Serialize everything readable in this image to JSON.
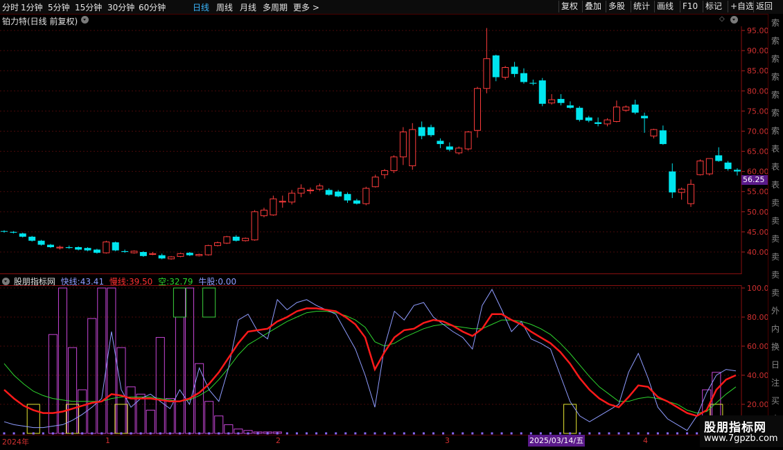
{
  "toolbar": {
    "periods": [
      "分时",
      "1分钟",
      "5分钟",
      "15分钟",
      "30分钟",
      "60分钟",
      "日线",
      "周线",
      "月线",
      "多周期",
      "更多 >"
    ],
    "active_period": "日线",
    "right_buttons": [
      "复权",
      "叠加",
      "多股",
      "统计",
      "画线",
      "F10",
      "标记",
      "+自选",
      "返回"
    ]
  },
  "title": "铂力特(日线 前复权)",
  "price_axis": [
    "95.00",
    "90.00",
    "85.00",
    "80.00",
    "75.00",
    "70.00",
    "65.00",
    "60.00",
    "55.00",
    "50.00",
    "45.00",
    "40.00"
  ],
  "last_price": "56.25",
  "indicator": {
    "name": "股朋指标网",
    "fast_label": "快线:",
    "fast_value": "43.41",
    "slow_label": "慢线:",
    "slow_value": "39.50",
    "empty_label": "空:",
    "empty_value": "32.79",
    "bull_label": "牛股:",
    "bull_value": "0.00",
    "axis": [
      "100.0",
      "80.00",
      "60.00",
      "40.00",
      "20.00"
    ],
    "colors": {
      "fast": "#8f9cff",
      "slow": "#ff1a1a",
      "empty": "#2ed62e",
      "bars": "#c846d8",
      "boxes_up": "#e6e632",
      "boxes_down": "#3cd23c"
    }
  },
  "date_axis": [
    "2024年",
    "1",
    "2",
    "3",
    "4"
  ],
  "crosshair_date": "2025/03/14/五",
  "right_strip_chars": [
    "索",
    "索",
    "索",
    "索",
    "索",
    "索",
    "索",
    "表",
    "表",
    "表",
    "卖",
    "卖",
    "卖",
    "卖",
    "卖",
    "卖",
    "外",
    "内",
    "换",
    "日",
    "注",
    "买",
    "卖"
  ],
  "watermark": {
    "line1": "股朋指标网",
    "line2": "www.7gpzb.com"
  },
  "chart_data": [
    {
      "type": "candlestick",
      "title": "铂力特(日线 前复权)",
      "ylim": [
        35,
        97
      ],
      "up_color": "#ff3c3c",
      "down_color": "#00e5ee",
      "candles": [
        [
          45.2,
          45.4,
          44.8,
          45.1
        ],
        [
          45.0,
          45.2,
          44.6,
          44.8
        ],
        [
          44.6,
          44.8,
          43.6,
          43.8
        ],
        [
          43.8,
          44.0,
          42.6,
          42.8
        ],
        [
          42.8,
          43.0,
          41.6,
          41.8
        ],
        [
          41.8,
          42.0,
          41.0,
          41.2
        ],
        [
          41.0,
          41.6,
          40.6,
          41.2
        ],
        [
          41.2,
          41.6,
          40.8,
          41.0
        ],
        [
          41.2,
          41.4,
          40.4,
          40.6
        ],
        [
          41.0,
          41.2,
          40.2,
          40.4
        ],
        [
          40.6,
          40.8,
          39.6,
          39.8
        ],
        [
          39.8,
          42.8,
          39.6,
          42.5
        ],
        [
          42.4,
          42.6,
          40.2,
          40.4
        ],
        [
          40.2,
          40.6,
          39.8,
          40.0
        ],
        [
          39.8,
          40.4,
          39.6,
          40.2
        ],
        [
          40.0,
          40.2,
          38.8,
          39.0
        ],
        [
          39.4,
          40.0,
          39.2,
          39.6
        ],
        [
          39.2,
          39.6,
          38.2,
          38.4
        ],
        [
          38.3,
          39.0,
          38.1,
          38.8
        ],
        [
          38.9,
          39.8,
          38.7,
          39.6
        ],
        [
          39.8,
          40.0,
          39.0,
          39.2
        ],
        [
          39.1,
          39.6,
          38.9,
          39.4
        ],
        [
          39.3,
          41.8,
          39.1,
          41.6
        ],
        [
          41.6,
          42.6,
          41.4,
          42.3
        ],
        [
          42.2,
          44.0,
          42.0,
          43.8
        ],
        [
          43.8,
          44.2,
          42.6,
          42.8
        ],
        [
          42.8,
          43.6,
          42.6,
          43.4
        ],
        [
          43.0,
          50.4,
          42.8,
          50.0
        ],
        [
          49.0,
          51.0,
          48.6,
          50.4
        ],
        [
          49.2,
          54.0,
          49.0,
          53.2
        ],
        [
          52.4,
          54.0,
          51.0,
          52.6
        ],
        [
          52.4,
          55.4,
          51.8,
          54.6
        ],
        [
          54.6,
          56.8,
          53.6,
          55.8
        ],
        [
          55.2,
          56.0,
          54.4,
          55.4
        ],
        [
          55.6,
          57.0,
          55.2,
          56.4
        ],
        [
          55.4,
          55.8,
          54.0,
          54.2
        ],
        [
          55.0,
          55.4,
          53.6,
          53.8
        ],
        [
          54.4,
          54.8,
          52.2,
          52.8
        ],
        [
          52.8,
          53.2,
          51.8,
          52.0
        ],
        [
          52.0,
          56.2,
          51.6,
          55.8
        ],
        [
          56.2,
          59.2,
          56.0,
          58.6
        ],
        [
          59.2,
          60.6,
          58.2,
          60.2
        ],
        [
          60.2,
          64.0,
          59.6,
          63.6
        ],
        [
          63.6,
          71.0,
          61.6,
          69.8
        ],
        [
          61.4,
          72.0,
          60.4,
          70.4
        ],
        [
          71.0,
          72.4,
          68.0,
          68.8
        ],
        [
          71.0,
          71.6,
          68.6,
          69.0
        ],
        [
          67.6,
          68.2,
          65.8,
          66.8
        ],
        [
          66.2,
          67.2,
          65.0,
          65.4
        ],
        [
          64.6,
          66.2,
          64.2,
          65.8
        ],
        [
          65.6,
          70.0,
          65.2,
          69.8
        ],
        [
          70.2,
          81.0,
          68.4,
          80.6
        ],
        [
          80.6,
          95.6,
          79.4,
          88.0
        ],
        [
          88.8,
          89.0,
          82.4,
          83.4
        ],
        [
          83.4,
          86.2,
          82.8,
          85.8
        ],
        [
          86.0,
          87.2,
          83.4,
          84.2
        ],
        [
          84.4,
          85.6,
          81.8,
          82.2
        ],
        [
          82.0,
          82.8,
          81.4,
          81.8
        ],
        [
          82.6,
          83.2,
          76.2,
          76.8
        ],
        [
          77.0,
          79.2,
          76.6,
          77.8
        ],
        [
          78.0,
          79.2,
          76.4,
          77.0
        ],
        [
          76.4,
          77.4,
          75.6,
          75.8
        ],
        [
          75.8,
          76.2,
          72.4,
          72.8
        ],
        [
          73.4,
          73.8,
          72.2,
          72.6
        ],
        [
          72.2,
          73.4,
          71.2,
          71.8
        ],
        [
          71.8,
          73.2,
          71.2,
          72.8
        ],
        [
          72.4,
          77.6,
          72.2,
          76.0
        ],
        [
          75.2,
          76.4,
          74.8,
          76.0
        ],
        [
          76.6,
          77.8,
          74.2,
          74.6
        ],
        [
          73.8,
          74.6,
          69.6,
          73.2
        ],
        [
          68.8,
          70.6,
          68.2,
          70.4
        ],
        [
          70.2,
          71.4,
          66.6,
          66.8
        ],
        [
          60.0,
          62.0,
          53.4,
          54.8
        ],
        [
          54.8,
          56.0,
          53.0,
          55.6
        ],
        [
          52.0,
          58.0,
          51.2,
          56.8
        ],
        [
          59.2,
          63.0,
          59.0,
          62.6
        ],
        [
          59.4,
          63.2,
          59.0,
          63.2
        ],
        [
          64.0,
          66.0,
          62.4,
          62.6
        ],
        [
          62.2,
          62.6,
          60.2,
          60.6
        ],
        [
          60.4,
          60.8,
          59.0,
          60.0
        ]
      ]
    },
    {
      "type": "line",
      "title": "股朋指标网",
      "ylim": [
        0,
        110
      ],
      "series": [
        {
          "name": "快线",
          "values": [
            8,
            6,
            5,
            4,
            4,
            5,
            6,
            9,
            13,
            18,
            24,
            70,
            30,
            18,
            24,
            27,
            22,
            17,
            30,
            20,
            45,
            30,
            22,
            45,
            78,
            82,
            70,
            65,
            92,
            85,
            90,
            92,
            88,
            85,
            82,
            70,
            58,
            40,
            18,
            60,
            84,
            78,
            88,
            90,
            80,
            75,
            70,
            66,
            58,
            88,
            99,
            85,
            70,
            77,
            65,
            62,
            58,
            40,
            22,
            12,
            8,
            12,
            16,
            20,
            42,
            55,
            38,
            18,
            10,
            6,
            2,
            12,
            28,
            40,
            44,
            43
          ]
        },
        {
          "name": "慢线",
          "values": [
            30,
            24,
            19,
            16,
            14,
            14,
            15,
            17,
            19,
            21,
            22,
            27,
            26,
            24,
            24,
            24,
            23,
            22,
            22,
            24,
            28,
            34,
            42,
            52,
            62,
            70,
            71,
            72,
            77,
            80,
            84,
            86,
            86,
            85,
            84,
            80,
            75,
            66,
            44,
            56,
            66,
            71,
            72,
            76,
            78,
            77,
            74,
            70,
            67,
            72,
            82,
            82,
            78,
            75,
            70,
            66,
            62,
            56,
            48,
            38,
            30,
            24,
            20,
            18,
            25,
            33,
            32,
            25,
            22,
            18,
            14,
            12,
            16,
            30,
            37,
            40
          ]
        },
        {
          "name": "空",
          "values": [
            48,
            40,
            34,
            29,
            26,
            24,
            23,
            22,
            22,
            22,
            22,
            24,
            25,
            25,
            25,
            25,
            24,
            23,
            22,
            23,
            26,
            30,
            37,
            45,
            54,
            61,
            65,
            69,
            73,
            77,
            80,
            83,
            84,
            84,
            83,
            81,
            78,
            73,
            63,
            60,
            62,
            66,
            69,
            72,
            74,
            75,
            74,
            73,
            72,
            72,
            75,
            78,
            78,
            77,
            75,
            72,
            68,
            62,
            55,
            47,
            39,
            32,
            27,
            22,
            22,
            24,
            25,
            24,
            22,
            20,
            16,
            14,
            15,
            21,
            27,
            32
          ]
        },
        {
          "name": "牛股",
          "values": [
            0,
            0,
            0,
            0,
            0,
            0,
            0,
            0,
            0,
            0,
            0,
            0,
            0,
            0,
            0,
            0,
            0,
            0,
            0,
            0,
            0,
            0,
            0,
            0,
            0,
            0,
            0,
            0,
            0,
            0,
            0,
            0,
            0,
            0,
            0,
            0,
            0,
            0,
            0,
            0,
            0,
            0,
            0,
            0,
            0,
            0,
            0,
            0,
            0,
            0,
            0,
            0,
            0,
            0,
            0,
            0,
            0,
            0,
            0,
            0,
            0,
            0,
            0,
            0,
            0,
            0,
            0,
            0,
            0,
            0,
            0,
            0,
            0,
            0,
            0,
            0
          ]
        }
      ],
      "histogram": [
        0,
        0,
        0,
        0,
        0,
        68,
        100,
        59,
        30,
        79,
        100,
        100,
        59,
        32,
        27,
        16,
        66,
        24,
        80,
        100,
        48,
        22,
        12,
        6,
        3,
        2,
        1,
        1,
        1,
        0,
        0,
        0,
        0,
        0,
        0,
        0,
        0,
        0,
        0,
        0,
        0,
        0,
        0,
        0,
        0,
        0,
        0,
        0,
        0,
        0,
        0,
        0,
        0,
        0,
        0,
        0,
        0,
        0,
        0,
        0,
        0,
        0,
        0,
        0,
        0,
        0,
        0,
        0,
        0,
        0,
        0,
        0,
        30,
        42,
        0,
        0
      ]
    }
  ]
}
